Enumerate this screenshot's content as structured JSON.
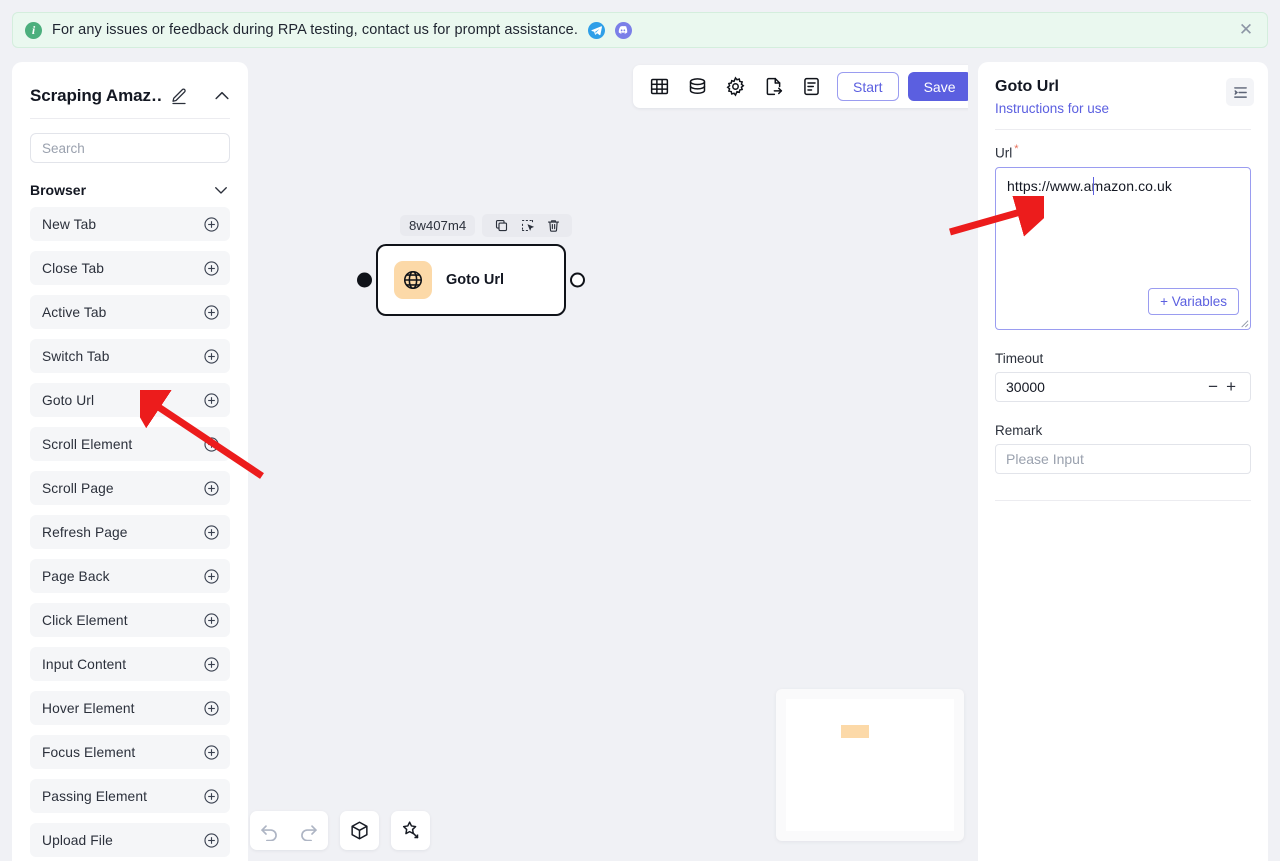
{
  "banner": {
    "icon": "info-icon",
    "text": "For any issues or feedback during RPA testing, contact us for prompt assistance.",
    "telegram_icon": "telegram-icon",
    "discord_icon": "discord-icon",
    "close_icon": "close-icon",
    "bg_color": "#eaf8ef",
    "icon_color": "#4caf7d"
  },
  "sidebar": {
    "title": "Scraping Amaz…",
    "edit_icon": "pencil-edit-icon",
    "collapse_icon": "chevron-up-icon",
    "search_placeholder": "Search",
    "group": {
      "label": "Browser",
      "chevron_icon": "chevron-down-icon"
    },
    "items": [
      {
        "label": "New Tab",
        "add_icon": "plus-circle-icon"
      },
      {
        "label": "Close Tab",
        "add_icon": "plus-circle-icon"
      },
      {
        "label": "Active Tab",
        "add_icon": "plus-circle-icon"
      },
      {
        "label": "Switch Tab",
        "add_icon": "plus-circle-icon"
      },
      {
        "label": "Goto Url",
        "add_icon": "plus-circle-icon"
      },
      {
        "label": "Scroll Element",
        "add_icon": "plus-circle-icon"
      },
      {
        "label": "Scroll Page",
        "add_icon": "plus-circle-icon"
      },
      {
        "label": "Refresh Page",
        "add_icon": "plus-circle-icon"
      },
      {
        "label": "Page Back",
        "add_icon": "plus-circle-icon"
      },
      {
        "label": "Click Element",
        "add_icon": "plus-circle-icon"
      },
      {
        "label": "Input Content",
        "add_icon": "plus-circle-icon"
      },
      {
        "label": "Hover Element",
        "add_icon": "plus-circle-icon"
      },
      {
        "label": "Focus Element",
        "add_icon": "plus-circle-icon"
      },
      {
        "label": "Passing Element",
        "add_icon": "plus-circle-icon"
      },
      {
        "label": "Upload File",
        "add_icon": "plus-circle-icon"
      }
    ]
  },
  "toolbar": {
    "icons": [
      {
        "name": "table-grid-icon"
      },
      {
        "name": "database-icon"
      },
      {
        "name": "gear-settings-icon"
      },
      {
        "name": "file-export-icon"
      },
      {
        "name": "log-document-icon"
      }
    ],
    "start_label": "Start",
    "save_label": "Save",
    "accent_color": "#5b5fe0"
  },
  "canvas": {
    "node": {
      "id": "8w407m4",
      "label": "Goto Url",
      "icon": "globe-icon",
      "icon_bg": "#fcd9a8",
      "actions": [
        {
          "name": "copy-node-icon"
        },
        {
          "name": "select-node-icon"
        },
        {
          "name": "delete-node-icon"
        }
      ],
      "input_port": "input-port",
      "output_port": "output-port"
    },
    "controls": [
      {
        "name": "undo-icon",
        "dim": true
      },
      {
        "name": "redo-icon",
        "dim": true
      },
      {
        "name": "package-cube-icon",
        "dim": false
      },
      {
        "name": "magic-wand-icon",
        "dim": false
      }
    ],
    "minimap": {
      "name": "minimap",
      "node_color": "#fcd9a8"
    }
  },
  "right_panel": {
    "title": "Goto Url",
    "instructions_link": "Instructions for use",
    "panel_toggle_icon": "list-indent-icon",
    "url_field": {
      "label": "Url",
      "required_marker": "*",
      "value": "https://www.amazon.co.uk",
      "variables_button": "+ Variables"
    },
    "timeout_field": {
      "label": "Timeout",
      "value": "30000",
      "minus": "−",
      "plus": "+"
    },
    "remark_field": {
      "label": "Remark",
      "placeholder": "Please Input"
    }
  }
}
